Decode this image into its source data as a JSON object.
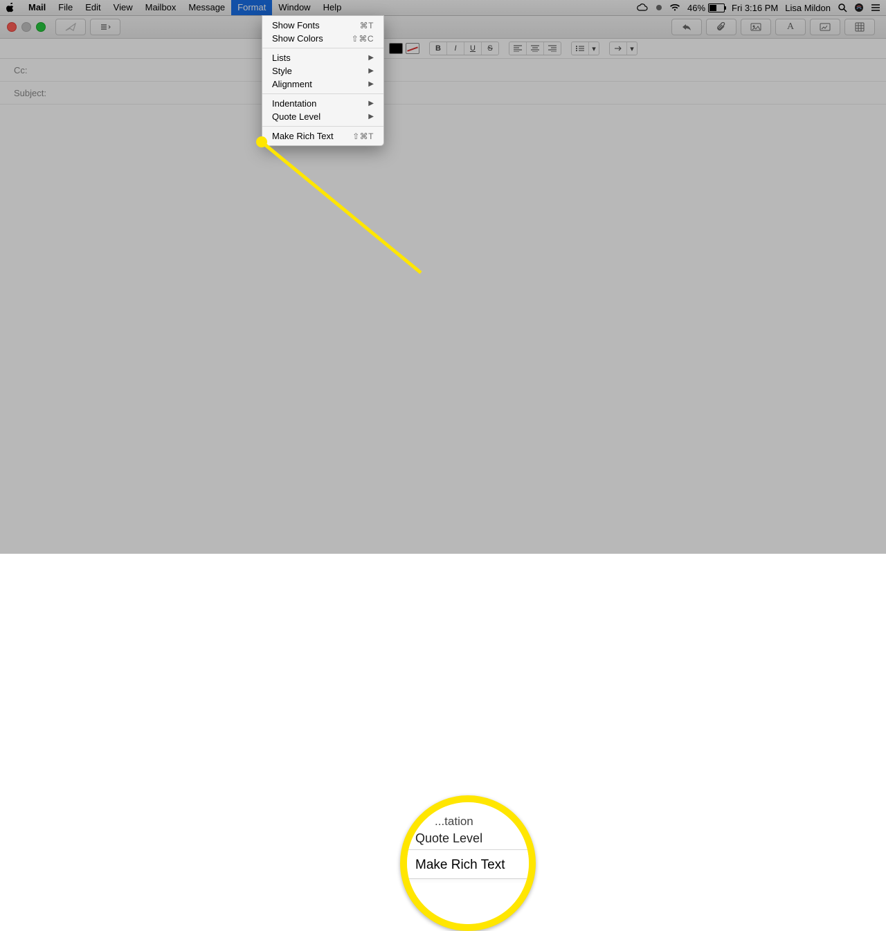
{
  "menubar": {
    "app": "Mail",
    "items": [
      "File",
      "Edit",
      "View",
      "Mailbox",
      "Message",
      "Format",
      "Window",
      "Help"
    ],
    "open_index": 5,
    "status": {
      "battery_pct": "46%",
      "clock": "Fri 3:16 PM",
      "user": "Lisa Mildon"
    }
  },
  "format_menu": {
    "groups": [
      [
        {
          "label": "Show Fonts",
          "shortcut": "⌘T"
        },
        {
          "label": "Show Colors",
          "shortcut": "⇧⌘C"
        }
      ],
      [
        {
          "label": "Lists",
          "submenu": true
        },
        {
          "label": "Style",
          "submenu": true
        },
        {
          "label": "Alignment",
          "submenu": true
        }
      ],
      [
        {
          "label": "Indentation",
          "submenu": true
        },
        {
          "label": "Quote Level",
          "submenu": true
        }
      ],
      [
        {
          "label": "Make Rich Text",
          "shortcut": "⇧⌘T"
        }
      ]
    ]
  },
  "compose": {
    "fields": {
      "cc": "Cc:",
      "subject": "Subject:"
    }
  },
  "callout": {
    "line1": "...tation",
    "line2": "Quote Level",
    "line3": "Make Rich Text"
  }
}
